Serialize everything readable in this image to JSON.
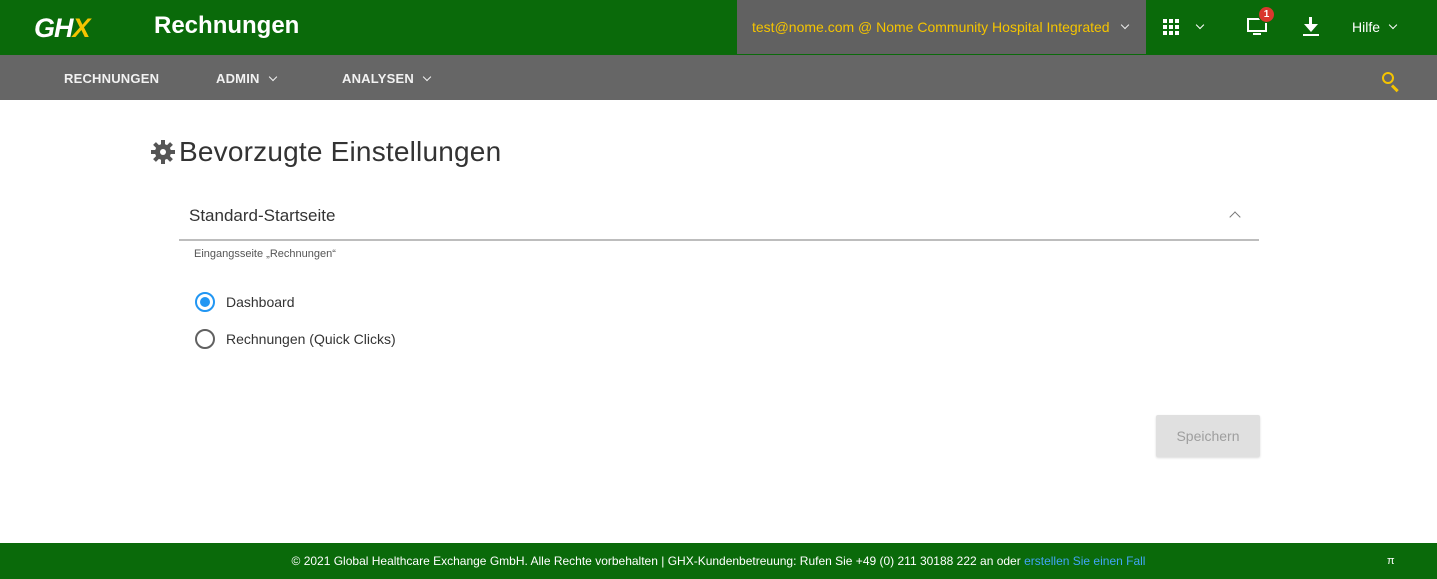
{
  "header": {
    "logo_text_main": "GH",
    "logo_text_x": "X",
    "app_title": "Rechnungen",
    "account_label": "test@nome.com @ Nome Community Hospital Integrated",
    "notification_count": "1",
    "help_label": "Hilfe"
  },
  "nav": {
    "items": [
      {
        "label": "RECHNUNGEN",
        "has_dropdown": false
      },
      {
        "label": "ADMIN",
        "has_dropdown": true
      },
      {
        "label": "ANALYSEN",
        "has_dropdown": true
      }
    ]
  },
  "page": {
    "title": "Bevorzugte Einstellungen",
    "section_title": "Standard-Startseite",
    "field_label": "Eingangsseite „Rechnungen“",
    "options": [
      {
        "label": "Dashboard",
        "selected": true
      },
      {
        "label": "Rechnungen (Quick Clicks)",
        "selected": false
      }
    ],
    "save_label": "Speichern"
  },
  "footer": {
    "text": "© 2021 Global Healthcare Exchange GmbH. Alle Rechte vorbehalten | GHX-Kundenbetreuung: Rufen Sie +49 (0) 211 30188 222 an oder ",
    "link_text": "erstellen Sie einen Fall",
    "pi_symbol": "π"
  },
  "colors": {
    "brand_green": "#0a6a0a",
    "accent_yellow": "#f5c400",
    "nav_gray": "#666666",
    "radio_blue": "#2196f3",
    "badge_red": "#d9382e"
  },
  "icons": [
    "ghx-logo",
    "chevron-down-icon",
    "apps-grid-icon",
    "monitor-icon",
    "download-icon",
    "search-icon",
    "gear-icon",
    "chevron-up-icon"
  ]
}
